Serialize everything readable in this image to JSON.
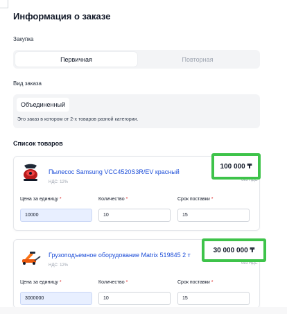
{
  "title": "Информация о заказе",
  "purchase": {
    "label": "Закупка",
    "options": [
      "Первичная",
      "Повторная"
    ],
    "selected": "Первичная"
  },
  "order_type": {
    "label": "Вид заказа",
    "value": "Объединенный",
    "description": "Это заказ в котором от 2-х товаров разной категории."
  },
  "products_title": "Список товаров",
  "field_labels": {
    "unit_price": "Цена за единицу",
    "quantity": "Количество",
    "delivery": "Срок поставки",
    "required_mark": "*"
  },
  "products": [
    {
      "name": "Пылесос Samsung VCC4520S3R/EV красный",
      "vat": "НДС: 12%",
      "total": "100 000 ₸",
      "no_vat": "без НДС",
      "unit_price": "10000",
      "quantity": "10",
      "delivery": "15",
      "thumb_icon": "vacuum-cleaner-icon"
    },
    {
      "name": "Грузоподъемное оборудование Matrix 519845 2 т",
      "vat": "НДС: 12%",
      "total": "30 000 000 ₸",
      "no_vat": "без НДС",
      "unit_price": "3000000",
      "quantity": "10",
      "delivery": "15",
      "thumb_icon": "jack-icon"
    }
  ],
  "colors": {
    "highlight_border": "#3ec34a",
    "link": "#1d4ed8",
    "required": "#dc2626",
    "active_input_bg": "#e8efff"
  }
}
